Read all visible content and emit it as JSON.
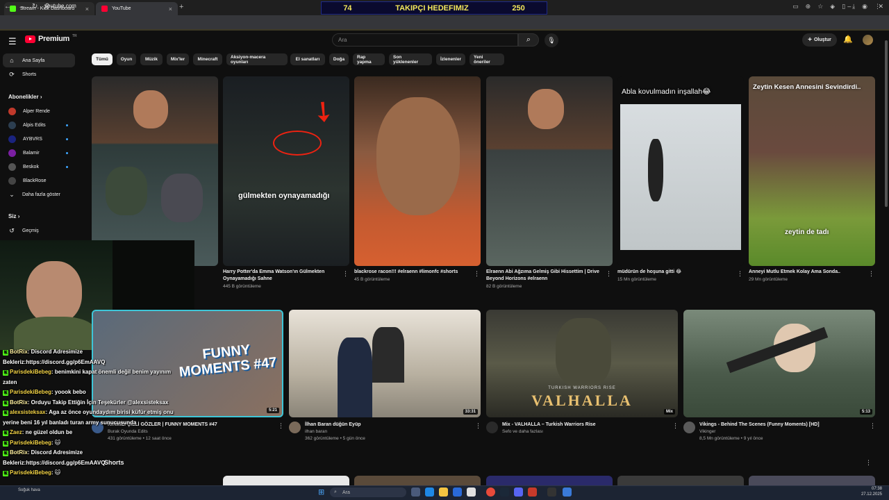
{
  "browser": {
    "tabs": [
      {
        "label": "Stream - Kick Dashboard"
      },
      {
        "label": "YouTube"
      }
    ],
    "new_tab": "+",
    "url": "youtube.com"
  },
  "goal_bar": {
    "current": "74",
    "label": "TAKIPÇI HEDEFIMIZ",
    "target": "250"
  },
  "header": {
    "logo_text": "Premium",
    "logo_region": "TR",
    "search_placeholder": "Ara",
    "create_label": "Oluştur"
  },
  "sidebar": {
    "main": [
      {
        "label": "Ana Sayfa",
        "icon": "home-icon"
      },
      {
        "label": "Shorts",
        "icon": "shorts-icon"
      }
    ],
    "subs_title": "Abonelikler",
    "subscriptions": [
      {
        "label": "Alper Rende",
        "color": "#c0392b",
        "live": false
      },
      {
        "label": "Alpis Edits",
        "color": "#2c3e50",
        "live": true
      },
      {
        "label": "AYBVRS",
        "color": "#1a237e",
        "live": true
      },
      {
        "label": "Balamir",
        "color": "#7b1fa2",
        "live": true
      },
      {
        "label": "Beskok",
        "color": "#555555",
        "live": true
      },
      {
        "label": "BlackRose",
        "color": "#444444",
        "live": false
      }
    ],
    "show_more": "Daha fazla göster",
    "you_title": "Siz",
    "history": "Geçmiş"
  },
  "chips": [
    "Tümü",
    "Oyun",
    "Müzik",
    "Mix'ler",
    "Minecraft",
    "Aksiyon-macera oyunları",
    "El sanatları",
    "Doğa",
    "Rap yapma",
    "Son yüklenenler",
    "İzlenenler",
    "Yeni öneriler"
  ],
  "shorts": [
    {
      "title": "",
      "views": ""
    },
    {
      "title": "Harry Potter'da Emma Watson'ın Gülmekten Oynayamadığı Sahne",
      "views": "445 B görüntüleme",
      "overlay": "gülmekten oynayamadığı"
    },
    {
      "title": "blackrose racon!!! #elraenn #limonfc #shorts",
      "views": "45 B görüntüleme"
    },
    {
      "title": "Elraenn Abi Ağzıma Gelmiş Gibi Hissettim | Drive Beyond Horizons #elraenn",
      "views": "82 B görüntüleme"
    },
    {
      "title": "müdürün de hoşuna gitti 😂",
      "views": "15 Mn görüntüleme",
      "overlay": "Abla kovulmadın inşallah😂"
    },
    {
      "title": "Anneyi Mutlu Etmek Kolay Ama Sonda..",
      "views": "29 Mn görüntüleme",
      "overlay": "Zeytin Kesen Annesini Sevindirdi..",
      "overlay2": "zeytin de tadı"
    }
  ],
  "videos": [
    {
      "title": "KIRMIZI ÇİLLİ GÖZLER | FUNNY MOMENTS #47",
      "channel": "Burak Oyunda Edits",
      "meta": "431 görüntüleme • 12 saat önce",
      "duration": "5:21",
      "thumb_text": "FUNNY MOMENTS #47"
    },
    {
      "title": "İlhan Baran düğün Eyüp",
      "channel": "ilhan baran",
      "meta": "362 görüntüleme • 5 gün önce",
      "duration": "33:31"
    },
    {
      "title": "Mix - VALHALLA – Turkish Warriors Rise",
      "channel": "Sefo ve daha fazlası",
      "meta": "",
      "duration": "Mix",
      "thumb_text": "VALHALLA",
      "thumb_sub": "TURKISH WARRIORS RISE"
    },
    {
      "title": "Vikings - Behind The Scenes (Funny Moments) [HD]",
      "channel": "Vikinger",
      "meta": "8,5 Mn görüntüleme • 9 yıl önce",
      "duration": "5:13"
    }
  ],
  "shorts_row_label": "Shorts",
  "chat": [
    {
      "user": "BotRix",
      "msg": ": Discord Adresimize"
    },
    {
      "user": "",
      "msg": "Bekleriz:https://discord.gg/p6EmAAVQ"
    },
    {
      "user": "ParisdekiBebeg",
      "msg": ": benimkini kapat önemli değil benim yayınım"
    },
    {
      "user": "",
      "msg": "zaten"
    },
    {
      "user": "ParisdekiBebeg",
      "msg": ": yoook bebo"
    },
    {
      "user": "BotRix",
      "msg": ": Orduyu Takip Ettiğin İçin Teşekürler @alexsisteksax"
    },
    {
      "user": "alexsisteksax",
      "msg": ": Aga az önce oyundaydım birisi küfür etmiş onu"
    },
    {
      "user": "",
      "msg": "yerine beni 16 yıl banladı turan army sunucusunda"
    },
    {
      "user": "Zaez",
      "msg": ": ne güzel oldun be"
    },
    {
      "user": "ParisdekiBebeg",
      "msg": ": 🐱"
    },
    {
      "user": "BotRix",
      "msg": ": Discord Adresimize"
    },
    {
      "user": "",
      "msg": "Bekleriz:https://discord.gg/p6EmAAVQ"
    },
    {
      "user": "ParisdekiBebeg",
      "msg": ": 🐱"
    }
  ],
  "taskbar": {
    "weather": "Soğuk hava",
    "search": "Ara",
    "time": "07:38",
    "date": "27.12.2025"
  },
  "colors": {
    "accent": "#ff0033",
    "kick_green": "#53fc18",
    "goal_yellow": "#f4e85a"
  }
}
